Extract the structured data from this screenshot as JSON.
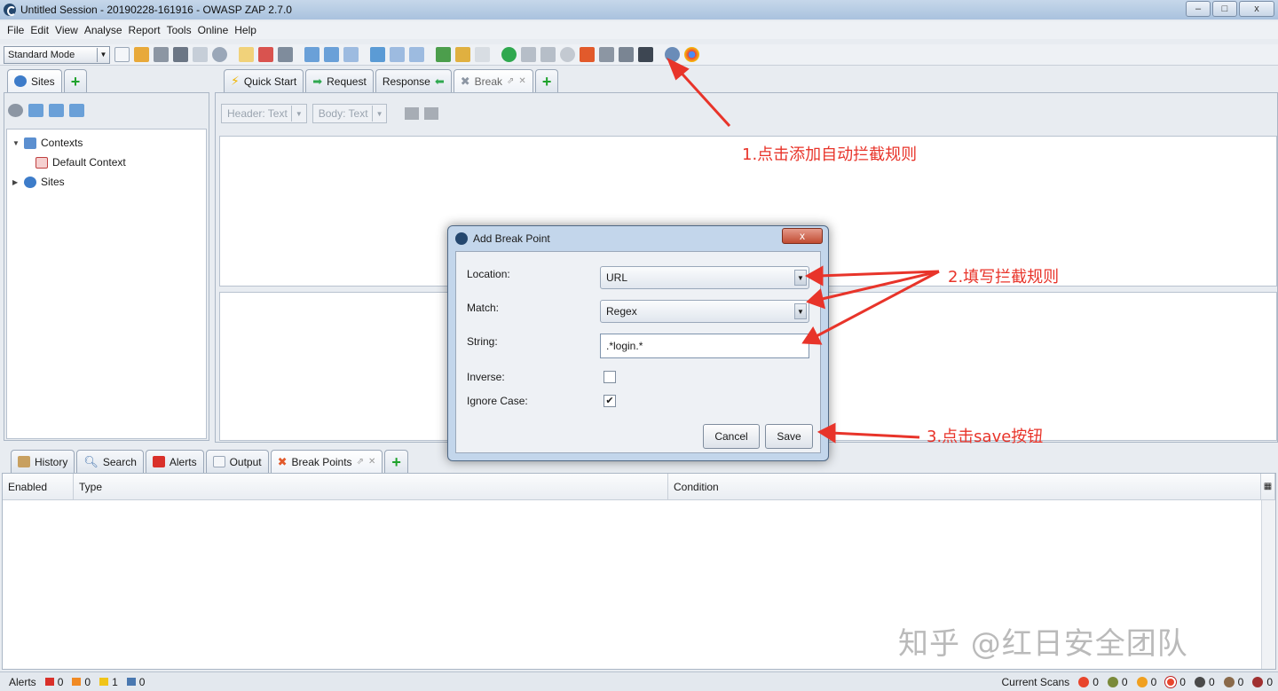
{
  "window": {
    "title": "Untitled Session - 20190228-161916 - OWASP ZAP 2.7.0",
    "minimize": "–",
    "maximize": "□",
    "close": "x"
  },
  "menu": [
    "File",
    "Edit",
    "View",
    "Analyse",
    "Report",
    "Tools",
    "Online",
    "Help"
  ],
  "toolbar": {
    "mode": "Standard Mode"
  },
  "left_tabs": {
    "sites": "Sites",
    "add": "+"
  },
  "tree": {
    "contexts": "Contexts",
    "default_context": "Default Context",
    "sites": "Sites"
  },
  "main_tabs": {
    "quick_start": "Quick Start",
    "request": "Request",
    "response": "Response",
    "break": "Break",
    "add": "+"
  },
  "request_tools": {
    "header": "Header: Text",
    "body": "Body: Text"
  },
  "bottom_tabs": {
    "history": "History",
    "search": "Search",
    "alerts": "Alerts",
    "output": "Output",
    "break_points": "Break Points",
    "add": "+"
  },
  "table": {
    "columns": [
      "Enabled",
      "Type",
      "Condition"
    ]
  },
  "status": {
    "alerts_label": "Alerts",
    "alerts_counts": [
      "0",
      "0",
      "1",
      "0"
    ],
    "current_scans_label": "Current Scans",
    "scan_counts": [
      "0",
      "0",
      "0",
      "0",
      "0",
      "0",
      "0"
    ]
  },
  "dialog": {
    "title": "Add Break Point",
    "close": "x",
    "location_label": "Location:",
    "location_value": "URL",
    "match_label": "Match:",
    "match_value": "Regex",
    "string_label": "String:",
    "string_value": ".*login.*",
    "inverse_label": "Inverse:",
    "ignore_case_label": "Ignore Case:",
    "ignore_case_checked": "✔",
    "cancel": "Cancel",
    "save": "Save"
  },
  "annotations": {
    "step1": "1.点击添加自动拦截规则",
    "step2": "2.填写拦截规则",
    "step3": "3.点击save按钮"
  },
  "watermark": "知乎 @红日安全团队",
  "colors": {
    "annotation": "#e8342a",
    "title_bar": "#a9c2de",
    "dialog_frame": "#c3d6eb"
  }
}
